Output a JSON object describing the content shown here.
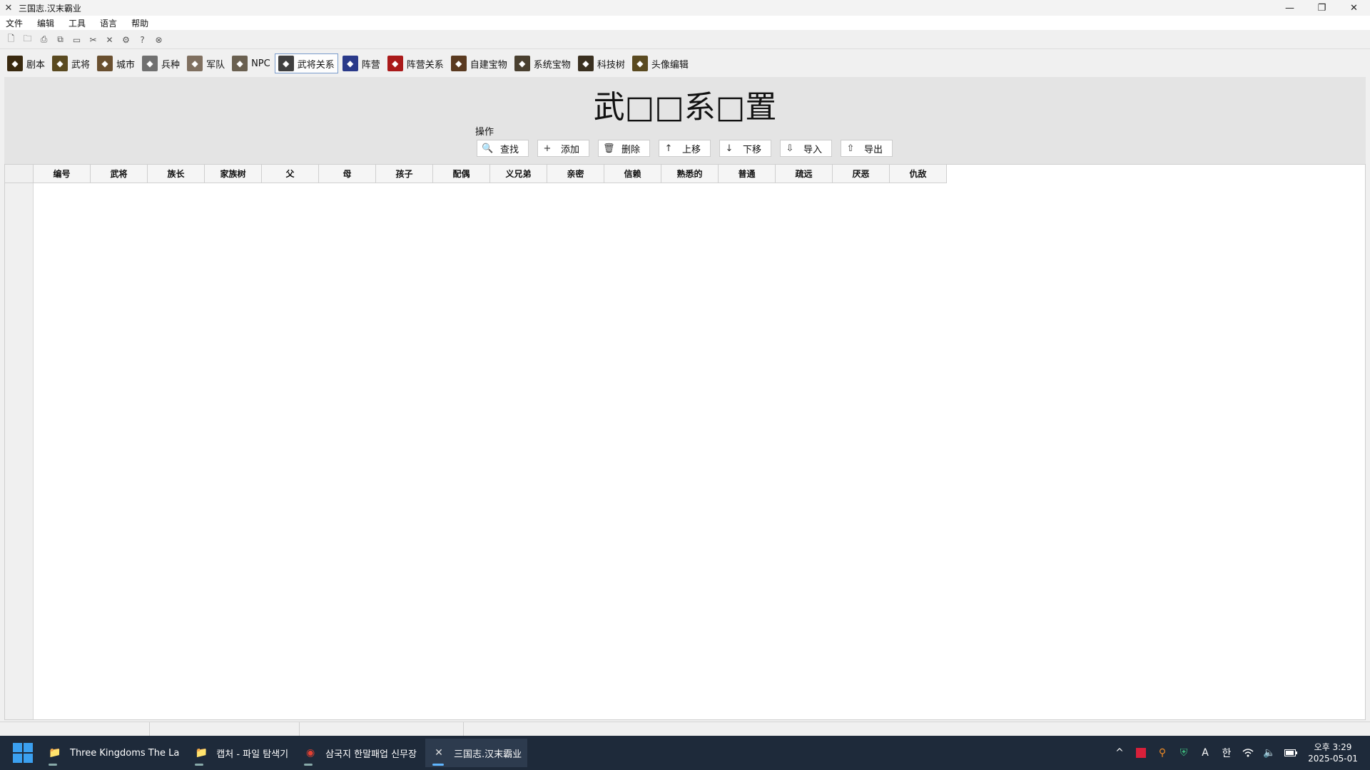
{
  "window": {
    "title": "三国志.汉末霸业",
    "controls": [
      "—",
      "❐",
      "✕"
    ]
  },
  "menu": [
    "文件",
    "编辑",
    "工具",
    "语言",
    "帮助"
  ],
  "toolbar_small": [
    "new-file-icon",
    "open-folder-icon",
    "print-icon",
    "copy-icon",
    "folder-icon",
    "cut-icon",
    "close-x-icon",
    "settings-icon",
    "help-icon",
    "language-icon"
  ],
  "tabs": [
    {
      "label": "剧本",
      "color": "#3a2a10"
    },
    {
      "label": "武将",
      "color": "#5a4a20"
    },
    {
      "label": "城市",
      "color": "#6a5030"
    },
    {
      "label": "兵种",
      "color": "#707070"
    },
    {
      "label": "军队",
      "color": "#807060"
    },
    {
      "label": "NPC",
      "color": "#6a6050"
    },
    {
      "label": "武将关系",
      "color": "#404040",
      "active": true
    },
    {
      "label": "阵营",
      "color": "#2a3a8a"
    },
    {
      "label": "阵营关系",
      "color": "#aa1a1a"
    },
    {
      "label": "自建宝物",
      "color": "#5a3a20"
    },
    {
      "label": "系统宝物",
      "color": "#4a4030"
    },
    {
      "label": "科技树",
      "color": "#3a3020"
    },
    {
      "label": "头像编辑",
      "color": "#5a4a20"
    }
  ],
  "panel": {
    "title": "武□□系□置",
    "ops_label": "操作",
    "buttons": [
      {
        "label": "查找",
        "icon": "🔍"
      },
      {
        "label": "添加",
        "icon": "+"
      },
      {
        "label": "删除",
        "icon": "🗑"
      },
      {
        "label": "上移",
        "icon": "↑"
      },
      {
        "label": "下移",
        "icon": "↓"
      },
      {
        "label": "导入",
        "icon": "⇩"
      },
      {
        "label": "导出",
        "icon": "⇧"
      }
    ]
  },
  "table": {
    "columns": [
      "编号",
      "武将",
      "族长",
      "家族树",
      "父",
      "母",
      "孩子",
      "配偶",
      "义兄弟",
      "亲密",
      "信赖",
      "熟悉的",
      "普通",
      "疏远",
      "厌恶",
      "仇敌"
    ],
    "rows": []
  },
  "taskbar": {
    "items": [
      {
        "label": "Three Kingdoms The La",
        "icon": "📁",
        "color": "#f2c14e"
      },
      {
        "label": "캡처 - 파일 탐색기",
        "icon": "📁",
        "color": "#f2c14e"
      },
      {
        "label": "삼국지 한말패업 신무장",
        "icon": "◉",
        "color": "#e34133"
      },
      {
        "label": "三国志.汉末霸业",
        "icon": "✕",
        "color": "#dddddd",
        "active": true
      }
    ],
    "tray": [
      "^",
      "◼",
      "⚲",
      "⛨",
      "A",
      "한",
      "wifi-icon",
      "volume-icon",
      "battery-icon"
    ],
    "clock": {
      "ampm_time": "오후 3:29",
      "date": "2025-05-01"
    }
  }
}
